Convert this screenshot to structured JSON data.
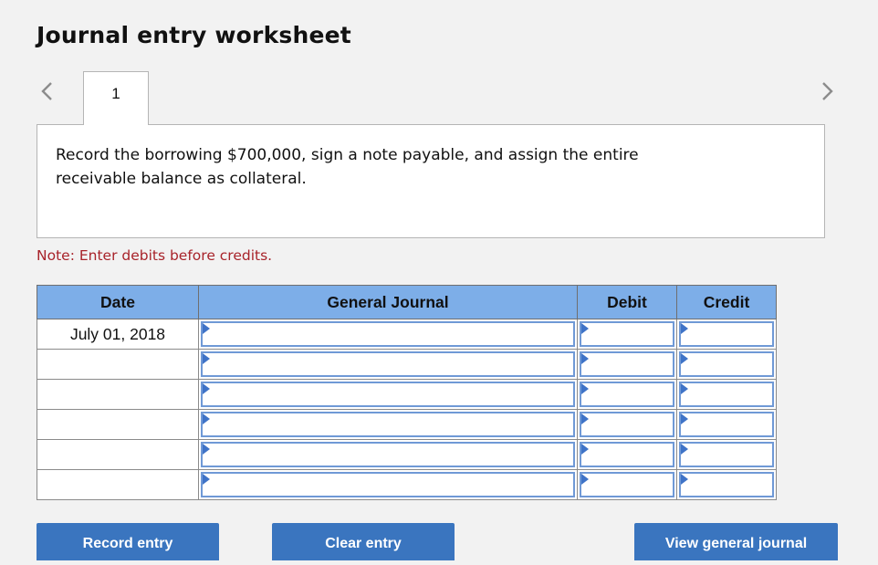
{
  "page": {
    "title": "Journal entry worksheet"
  },
  "navigation": {
    "prev_icon": "chevron-left-icon",
    "next_icon": "chevron-right-icon",
    "tabs": [
      {
        "label": "1",
        "active": true
      }
    ]
  },
  "instruction": {
    "line1": "Record the borrowing $700,000, sign a note payable, and assign the entire",
    "line2": "receivable balance as collateral."
  },
  "note": "Note: Enter debits before credits.",
  "journal": {
    "columns": {
      "date": "Date",
      "general_journal": "General Journal",
      "debit": "Debit",
      "credit": "Credit"
    },
    "rows": [
      {
        "date": "July 01, 2018",
        "account": "",
        "debit": "",
        "credit": ""
      },
      {
        "date": "",
        "account": "",
        "debit": "",
        "credit": ""
      },
      {
        "date": "",
        "account": "",
        "debit": "",
        "credit": ""
      },
      {
        "date": "",
        "account": "",
        "debit": "",
        "credit": ""
      },
      {
        "date": "",
        "account": "",
        "debit": "",
        "credit": ""
      },
      {
        "date": "",
        "account": "",
        "debit": "",
        "credit": ""
      }
    ]
  },
  "buttons": {
    "record": "Record entry",
    "clear": "Clear entry",
    "view": "View general journal"
  },
  "colors": {
    "header_bg": "#7daee8",
    "button_bg": "#3a75bf",
    "note_text": "#a8232a",
    "field_border": "#6f99d6",
    "dropdown_marker": "#3f73c7"
  }
}
